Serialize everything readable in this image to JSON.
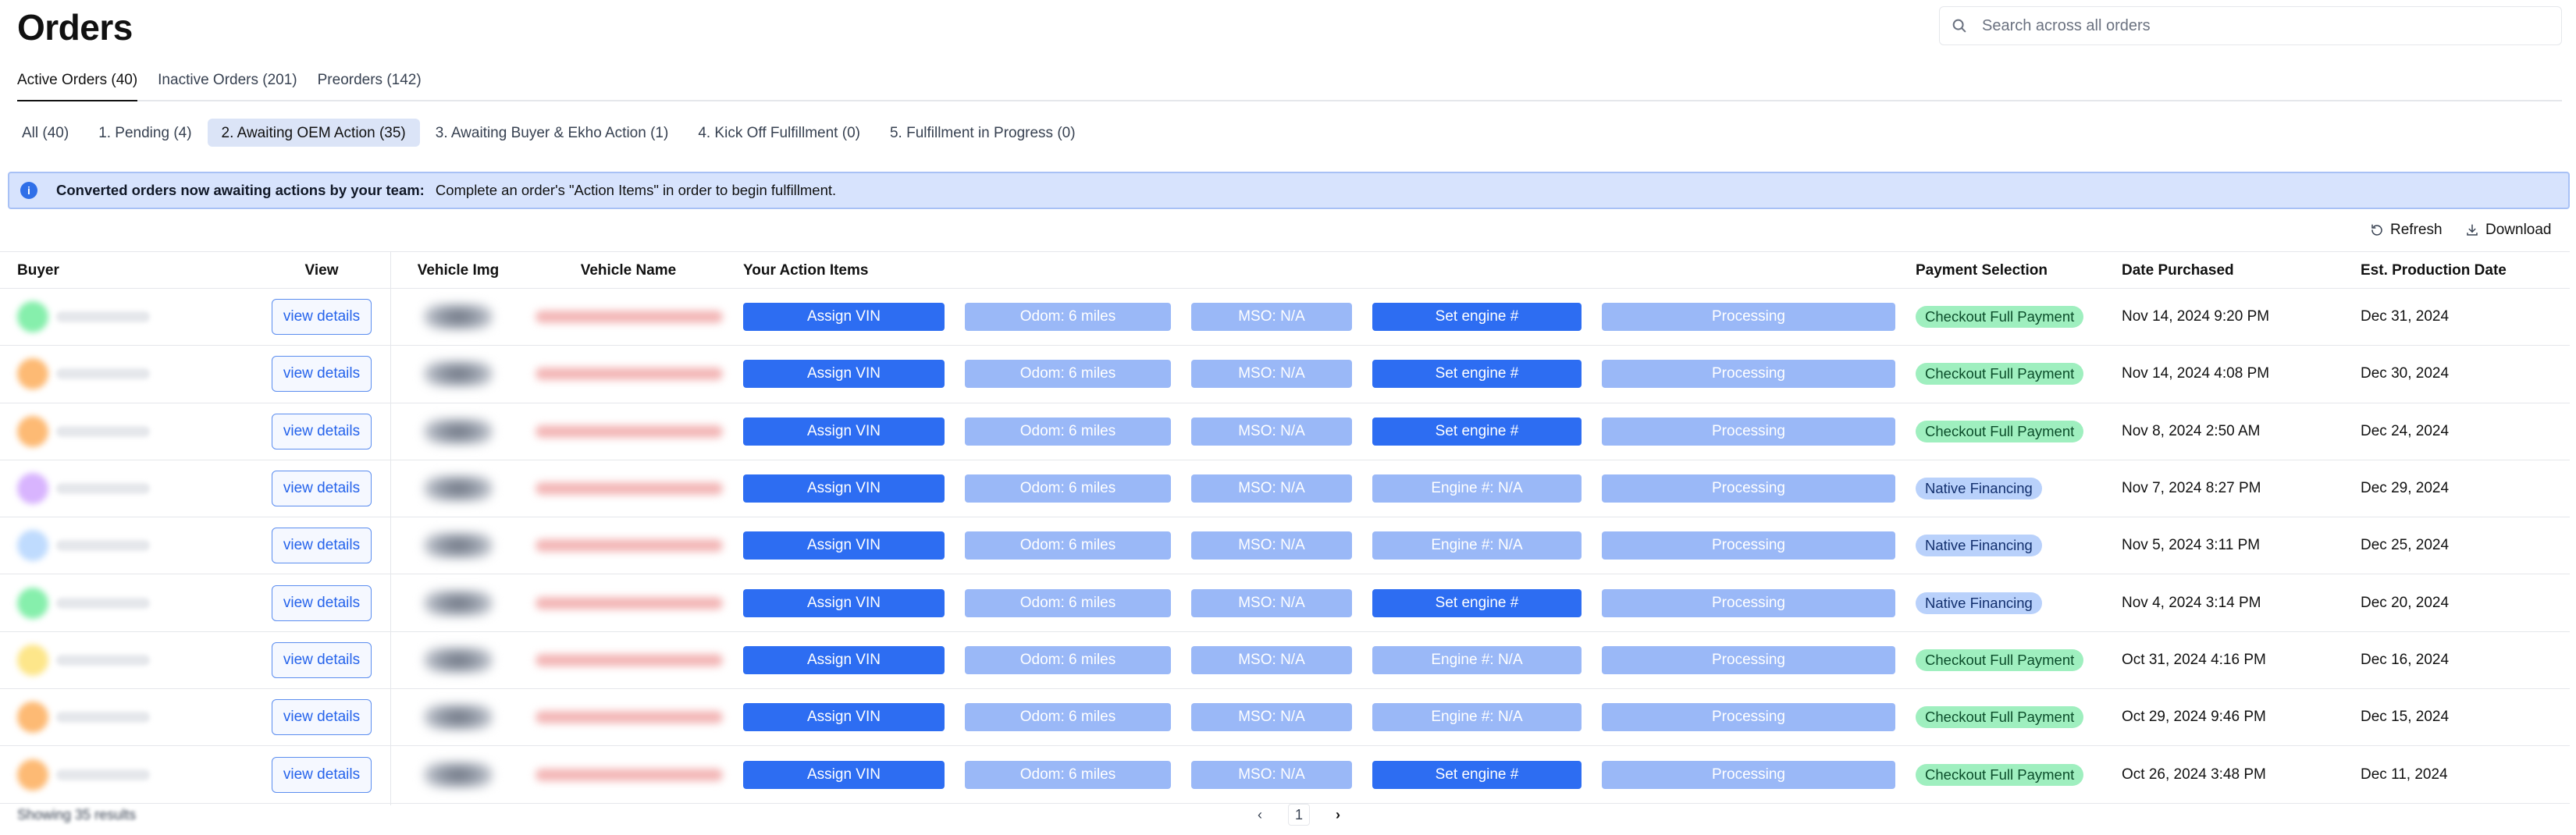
{
  "header": {
    "title": "Orders",
    "search_placeholder": "Search across all orders"
  },
  "main_tabs": [
    {
      "label": "Active Orders (40)",
      "active": true
    },
    {
      "label": "Inactive Orders (201)",
      "active": false
    },
    {
      "label": "Preorders (142)",
      "active": false
    }
  ],
  "sub_tabs": [
    {
      "label": "All (40)",
      "active": false
    },
    {
      "label": "1. Pending (4)",
      "active": false
    },
    {
      "label": "2. Awaiting OEM Action (35)",
      "active": true
    },
    {
      "label": "3. Awaiting Buyer & Ekho Action (1)",
      "active": false
    },
    {
      "label": "4. Kick Off Fulfillment (0)",
      "active": false
    },
    {
      "label": "5. Fulfillment in Progress (0)",
      "active": false
    }
  ],
  "banner": {
    "title": "Converted orders now awaiting actions by your team:",
    "text": "Complete an order's \"Action Items\" in order to begin fulfillment."
  },
  "toolbar": {
    "refresh_label": "Refresh",
    "download_label": "Download"
  },
  "table": {
    "headers": {
      "buyer": "Buyer",
      "view": "View",
      "vehicle_img": "Vehicle Img",
      "vehicle_name": "Vehicle Name",
      "actions": "Your Action Items",
      "payment": "Payment Selection",
      "date_purchased": "Date Purchased",
      "est_production": "Est. Production Date"
    },
    "rows": [
      {
        "avatar_color": "#86efac",
        "view_label": "view details",
        "assign_vin": "Assign VIN",
        "odom": "Odom: 6 miles",
        "mso": "MSO: N/A",
        "engine": "Set engine #",
        "engine_state": "action",
        "status": "Processing",
        "payment": "Checkout Full Payment",
        "payment_type": "green",
        "date_purchased": "Nov 14, 2024 9:20 PM",
        "est_production": "Dec 31, 2024"
      },
      {
        "avatar_color": "#fdba74",
        "view_label": "view details",
        "assign_vin": "Assign VIN",
        "odom": "Odom: 6 miles",
        "mso": "MSO: N/A",
        "engine": "Set engine #",
        "engine_state": "action",
        "status": "Processing",
        "payment": "Checkout Full Payment",
        "payment_type": "green",
        "date_purchased": "Nov 14, 2024 4:08 PM",
        "est_production": "Dec 30, 2024"
      },
      {
        "avatar_color": "#fdba74",
        "view_label": "view details",
        "assign_vin": "Assign VIN",
        "odom": "Odom: 6 miles",
        "mso": "MSO: N/A",
        "engine": "Set engine #",
        "engine_state": "action",
        "status": "Processing",
        "payment": "Checkout Full Payment",
        "payment_type": "green",
        "date_purchased": "Nov 8, 2024 2:50 AM",
        "est_production": "Dec 24, 2024"
      },
      {
        "avatar_color": "#d8b4fe",
        "view_label": "view details",
        "assign_vin": "Assign VIN",
        "odom": "Odom: 6 miles",
        "mso": "MSO: N/A",
        "engine": "Engine #: N/A",
        "engine_state": "muted",
        "status": "Processing",
        "payment": "Native Financing",
        "payment_type": "blue",
        "date_purchased": "Nov 7, 2024 8:27 PM",
        "est_production": "Dec 29, 2024"
      },
      {
        "avatar_color": "#bfdbfe",
        "view_label": "view details",
        "assign_vin": "Assign VIN",
        "odom": "Odom: 6 miles",
        "mso": "MSO: N/A",
        "engine": "Engine #: N/A",
        "engine_state": "muted",
        "status": "Processing",
        "payment": "Native Financing",
        "payment_type": "blue",
        "date_purchased": "Nov 5, 2024 3:11 PM",
        "est_production": "Dec 25, 2024"
      },
      {
        "avatar_color": "#86efac",
        "view_label": "view details",
        "assign_vin": "Assign VIN",
        "odom": "Odom: 6 miles",
        "mso": "MSO: N/A",
        "engine": "Set engine #",
        "engine_state": "action",
        "status": "Processing",
        "payment": "Native Financing",
        "payment_type": "blue",
        "date_purchased": "Nov 4, 2024 3:14 PM",
        "est_production": "Dec 20, 2024"
      },
      {
        "avatar_color": "#fde68a",
        "view_label": "view details",
        "assign_vin": "Assign VIN",
        "odom": "Odom: 6 miles",
        "mso": "MSO: N/A",
        "engine": "Engine #: N/A",
        "engine_state": "muted",
        "status": "Processing",
        "payment": "Checkout Full Payment",
        "payment_type": "green",
        "date_purchased": "Oct 31, 2024 4:16 PM",
        "est_production": "Dec 16, 2024"
      },
      {
        "avatar_color": "#fdba74",
        "view_label": "view details",
        "assign_vin": "Assign VIN",
        "odom": "Odom: 6 miles",
        "mso": "MSO: N/A",
        "engine": "Engine #: N/A",
        "engine_state": "muted",
        "status": "Processing",
        "payment": "Checkout Full Payment",
        "payment_type": "green",
        "date_purchased": "Oct 29, 2024 9:46 PM",
        "est_production": "Dec 15, 2024"
      },
      {
        "avatar_color": "#fdba74",
        "view_label": "view details",
        "assign_vin": "Assign VIN",
        "odom": "Odom: 6 miles",
        "mso": "MSO: N/A",
        "engine": "Set engine #",
        "engine_state": "action",
        "status": "Processing",
        "payment": "Checkout Full Payment",
        "payment_type": "green",
        "date_purchased": "Oct 26, 2024 3:48 PM",
        "est_production": "Dec 11, 2024"
      }
    ]
  },
  "pagination": {
    "current_page": "1",
    "prev_symbol": "‹",
    "next_symbol": "›"
  },
  "colors": {
    "primary": "#2d6df2",
    "primary_muted": "#9ab8f7",
    "banner_bg": "#d7e3fd",
    "badge_green": "#9fefbf",
    "badge_blue": "#b9d1fb"
  }
}
